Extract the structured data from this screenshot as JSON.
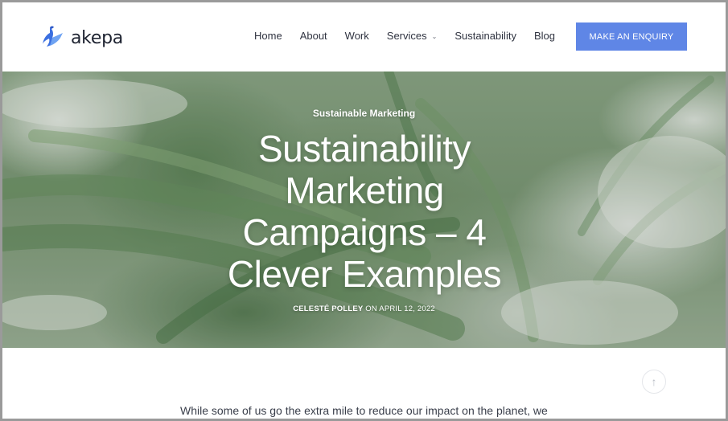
{
  "brand": {
    "logo_text": "akepa",
    "accent_color": "#5f86e6",
    "logo_icon": "bird-icon"
  },
  "nav": {
    "items": [
      {
        "label": "Home"
      },
      {
        "label": "About"
      },
      {
        "label": "Work"
      },
      {
        "label": "Services",
        "has_dropdown": true
      },
      {
        "label": "Sustainability"
      },
      {
        "label": "Blog"
      }
    ],
    "cta_label": "MAKE AN ENQUIRY"
  },
  "hero": {
    "category": "Sustainable Marketing",
    "title_lines": [
      "Sustainability",
      "Marketing",
      "Campaigns – 4",
      "Clever Examples"
    ],
    "author": "CELESTÉ POLLEY",
    "date_prefix": "ON",
    "date": "APRIL 12, 2022"
  },
  "content": {
    "intro_text": "While some of us go the extra mile to reduce our impact on the planet, we"
  },
  "back_to_top": {
    "icon": "arrow-up-icon"
  }
}
